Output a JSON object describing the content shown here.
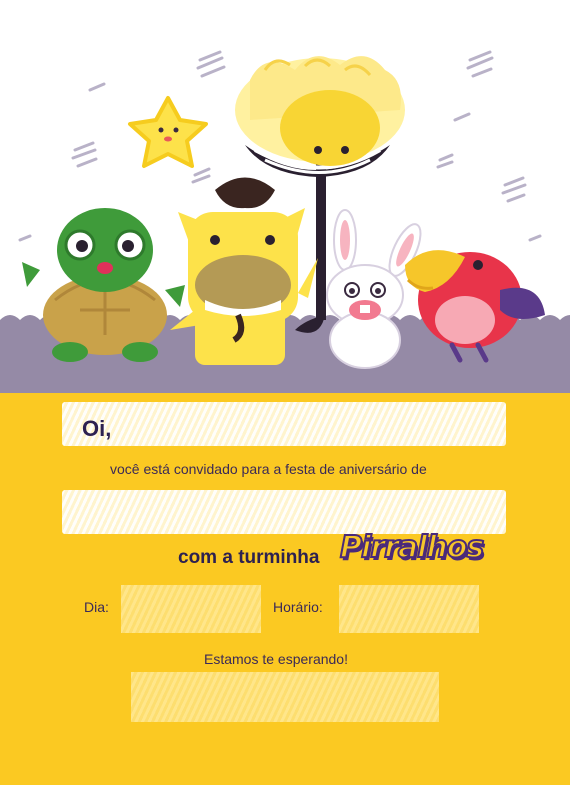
{
  "invitation": {
    "greeting": "Oi,",
    "invite_line": "você está convidado para a festa de aniversário de",
    "gang_line": "com a turminha",
    "brand_logo": "Pirralhos",
    "date_label": "Dia:",
    "time_label": "Horário:",
    "closing": "Estamos te esperando!"
  },
  "colors": {
    "bottom_background": "#fbc922",
    "ground_purple": "#958aa6",
    "text": "#2d2150"
  },
  "characters": [
    "star-icon",
    "sun-character",
    "turtle-character",
    "horse-character",
    "bunny-character",
    "parrot-character"
  ]
}
